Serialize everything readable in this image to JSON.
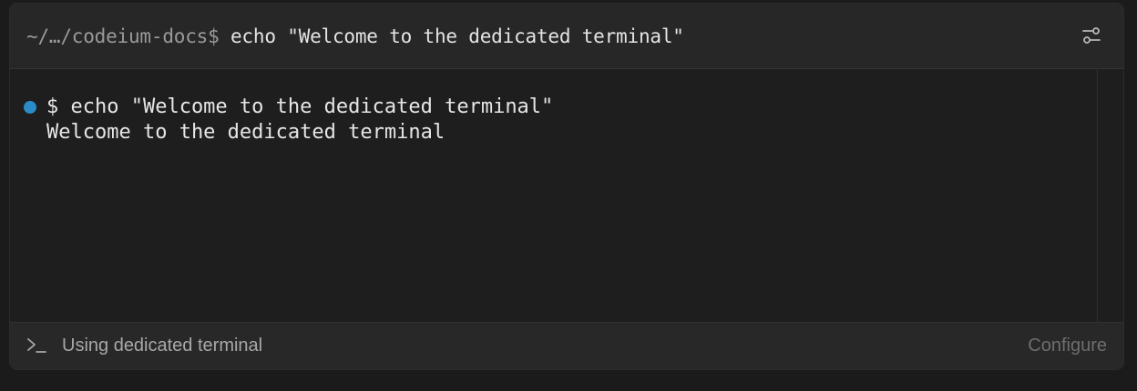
{
  "header": {
    "path": "~/…/codeium-docs$",
    "command": " echo \"Welcome to the dedicated terminal\"",
    "settings_icon": "sliders-icon"
  },
  "terminal": {
    "prompt_line": "$ echo \"Welcome to the dedicated terminal\"",
    "output_line": "Welcome to the dedicated terminal",
    "status_dot_color": "#2a8bc7"
  },
  "footer": {
    "icon": "terminal-prompt-icon",
    "label": "Using dedicated terminal",
    "configure_label": "Configure"
  }
}
